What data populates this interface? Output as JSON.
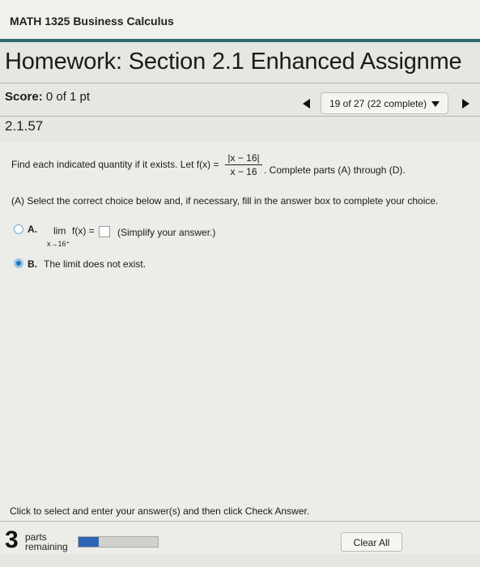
{
  "course": {
    "title": "MATH 1325 Business Calculus"
  },
  "homework": {
    "title": "Homework: Section 2.1 Enhanced Assignme"
  },
  "score": {
    "label": "Score:",
    "value": "0 of 1 pt"
  },
  "navigation": {
    "position_text": "19 of 27 (22 complete)"
  },
  "question": {
    "number": "2.1.57",
    "prompt_start": "Find each indicated quantity if it exists. Let f(x) =",
    "fraction_numerator": "|x − 16|",
    "fraction_denominator": "x − 16",
    "prompt_end": ". Complete parts (A) through (D).",
    "part_a_instruction": "(A) Select the correct choice below and, if necessary, fill in the answer box to complete your choice."
  },
  "options": [
    {
      "letter": "A.",
      "lim_text": "lim",
      "lim_sub": "x→16⁺",
      "expression": "f(x) =",
      "answer_value": "",
      "hint": "(Simplify your answer.)",
      "selected": false
    },
    {
      "letter": "B.",
      "text": "The limit does not exist.",
      "selected": true
    }
  ],
  "footer": {
    "instruction": "Click to select and enter your answer(s) and then click Check Answer.",
    "parts_remaining_count": "3",
    "parts_word": "parts",
    "remaining_word": "remaining",
    "progress_fraction": 0.25,
    "clear_all_label": "Clear All"
  },
  "colors": {
    "accent_teal": "#2f6a73",
    "selected_radio": "#1f73b8",
    "progress_fill": "#2d65b4"
  }
}
